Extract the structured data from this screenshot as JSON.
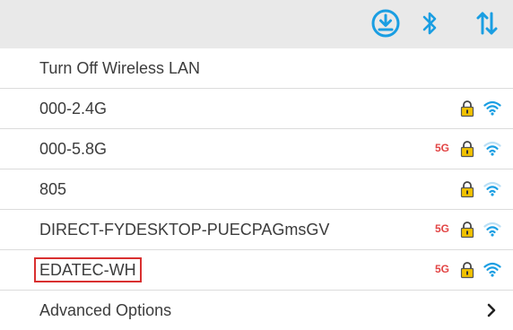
{
  "header": {
    "download_icon": "download-circle-icon",
    "bluetooth_icon": "bluetooth-icon",
    "transfer_icon": "up-down-arrows-icon",
    "accent_color": "#1a9ee2"
  },
  "menu": {
    "turn_off_label": "Turn Off Wireless LAN",
    "networks": [
      {
        "ssid": "000-2.4G",
        "band_badge": "",
        "secured": true,
        "signal": "strong"
      },
      {
        "ssid": "000-5.8G",
        "band_badge": "5G",
        "secured": true,
        "signal": "weak"
      },
      {
        "ssid": "805",
        "band_badge": "",
        "secured": true,
        "signal": "weak"
      },
      {
        "ssid": "DIRECT-FYDESKTOP-PUECPAGmsGV",
        "band_badge": "5G",
        "secured": true,
        "signal": "weak"
      },
      {
        "ssid": "EDATEC-WH",
        "band_badge": "5G",
        "secured": true,
        "signal": "strong",
        "highlighted": true
      }
    ],
    "advanced_label": "Advanced Options"
  },
  "colors": {
    "badge_5g": "#e24545",
    "lock": "#f2c200",
    "wifi": "#1a9ee2",
    "highlight_box": "#d93030"
  }
}
